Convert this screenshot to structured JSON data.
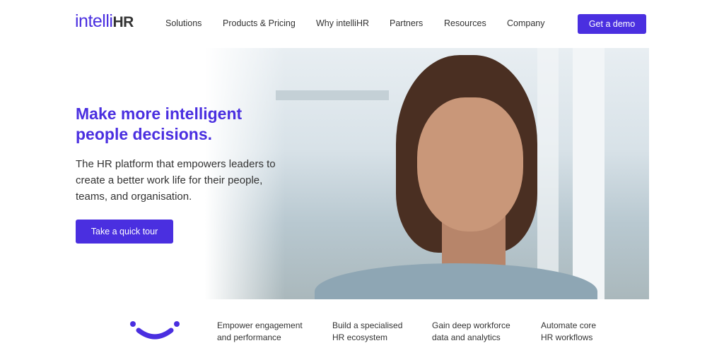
{
  "logo": {
    "part1": "intelli",
    "part2": "HR"
  },
  "nav": [
    "Solutions",
    "Products & Pricing",
    "Why intelliHR",
    "Partners",
    "Resources",
    "Company"
  ],
  "cta": "Get a demo",
  "hero": {
    "title_line1": "Make more intelligent",
    "title_line2": "people decisions.",
    "subtitle": "The HR platform that empowers leaders to create a better work life for their people, teams, and organisation.",
    "button": "Take a quick tour"
  },
  "features": [
    "Empower engagement\nand performance",
    "Build a specialised\nHR ecosystem",
    "Gain deep workforce\ndata and analytics",
    "Automate core\nHR workflows"
  ],
  "colors": {
    "brand": "#4a2fe0"
  }
}
